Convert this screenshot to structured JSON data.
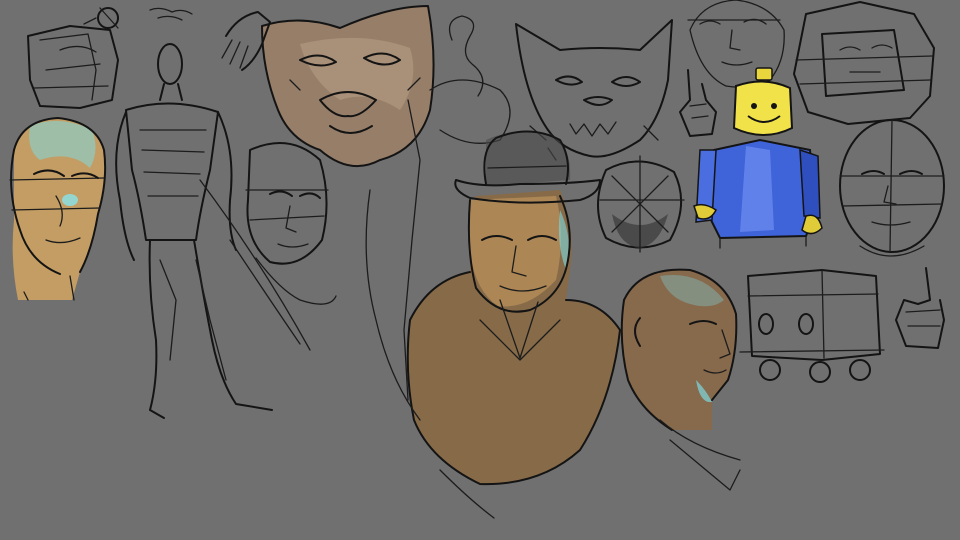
{
  "canvas": {
    "background": "#707070"
  },
  "palette": {
    "ink": "#141414",
    "skin_warm": "#c9a46a",
    "skin_brown": "#8a6a45",
    "highlight_cyan": "#7fd8e0",
    "lego_yellow": "#f2e24a",
    "lego_blue": "#3f63d8",
    "dog_fill": "#9a8068"
  },
  "sketches": [
    {
      "name": "mailbox-sketch-icon"
    },
    {
      "name": "figure-anatomy-sketch"
    },
    {
      "name": "bald-man-head-colored"
    },
    {
      "name": "man-head-sketch"
    },
    {
      "name": "wolf-face-colored"
    },
    {
      "name": "worm-squiggle-sketch"
    },
    {
      "name": "wolf-face-sketch"
    },
    {
      "name": "woman-face-sketch"
    },
    {
      "name": "hand-gesture-sketch"
    },
    {
      "name": "lego-minifigure-colored"
    },
    {
      "name": "cube-head-sketch"
    },
    {
      "name": "round-head-sketch"
    },
    {
      "name": "fedora-man-bust-colored"
    },
    {
      "name": "sphere-head-sketch"
    },
    {
      "name": "bald-man-profile-colored"
    },
    {
      "name": "truck-sketch"
    },
    {
      "name": "hand-gesture-sketch-2"
    }
  ]
}
